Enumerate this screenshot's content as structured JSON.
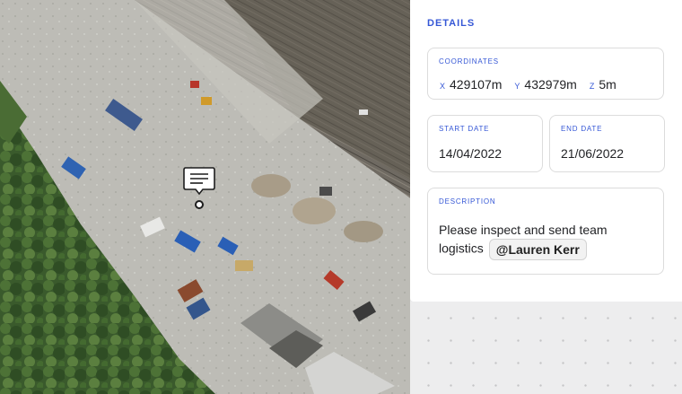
{
  "map": {
    "comment_marker_icon": "comment-icon"
  },
  "details": {
    "title": "DETAILS",
    "coordinates": {
      "label": "COORDINATES",
      "x_axis": "X",
      "x_value": "429107m",
      "y_axis": "Y",
      "y_value": "432979m",
      "z_axis": "Z",
      "z_value": "5m"
    },
    "start_date": {
      "label": "START DATE",
      "value": "14/04/2022"
    },
    "end_date": {
      "label": "END DATE",
      "value": "21/06/2022"
    },
    "description": {
      "label": "DESCRIPTION",
      "text": "Please inspect and send team logistics",
      "mention": "@Lauren Kerr"
    }
  },
  "colors": {
    "accent": "#3557d6",
    "text": "#222326",
    "border": "#dcdcdc",
    "panel_bg": "#ffffff",
    "backdrop": "#ededee"
  }
}
